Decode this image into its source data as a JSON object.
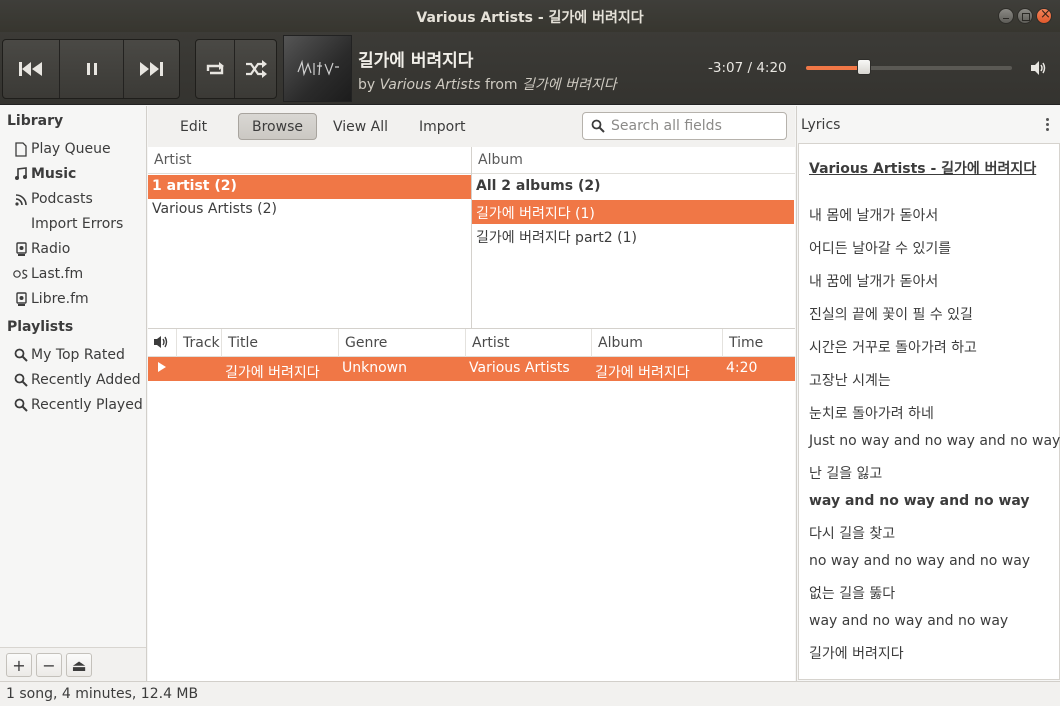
{
  "window": {
    "title": "Various Artists - 길가에 버려지다"
  },
  "now_playing": {
    "title": "길가에 버려지다",
    "by_prefix": "by",
    "artist": "Various Artists",
    "from_prefix": "from",
    "album": "길가에 버려지다",
    "time_display": "-3:07 / 4:20",
    "progress_fraction": 0.283
  },
  "sidebar": {
    "library_header": "Library",
    "library_items": [
      {
        "label": "Play Queue",
        "icon": "document-icon"
      },
      {
        "label": "Music",
        "icon": "music-note-icon",
        "bold": true
      },
      {
        "label": "Podcasts",
        "icon": "rss-feed-icon"
      },
      {
        "label": "Import Errors",
        "icon": ""
      },
      {
        "label": "Radio",
        "icon": "radio-icon"
      },
      {
        "label": "Last.fm",
        "icon": "lastfm-icon"
      },
      {
        "label": "Libre.fm",
        "icon": "librefm-icon"
      }
    ],
    "playlists_header": "Playlists",
    "playlist_items": [
      {
        "label": "My Top Rated",
        "icon": "search-icon"
      },
      {
        "label": "Recently Added",
        "icon": "search-icon"
      },
      {
        "label": "Recently Played",
        "icon": "search-icon"
      }
    ],
    "bottom_buttons": [
      "+",
      "−",
      "⏏"
    ]
  },
  "browser_toolbar": {
    "edit": "Edit",
    "browse": "Browse",
    "view_all": "View All",
    "import": "Import",
    "search_placeholder": "Search all fields"
  },
  "artist_pane": {
    "header": "Artist",
    "rows": [
      "1 artist (2)",
      "Various Artists (2)"
    ]
  },
  "album_pane": {
    "header": "Album",
    "rows": [
      "All 2 albums (2)",
      "길가에 버려지다 (1)",
      "길가에 버려지다 part2 (1)"
    ]
  },
  "tracklist": {
    "columns": [
      "Track",
      "Title",
      "Genre",
      "Artist",
      "Album",
      "Time"
    ],
    "rows": [
      {
        "track": "",
        "title": "길가에 버려지다",
        "genre": "Unknown",
        "artist": "Various Artists",
        "album": "길가에 버려지다",
        "time": "4:20"
      }
    ]
  },
  "lyrics": {
    "header": "Lyrics",
    "heading": "Various Artists - 길가에 버려지다",
    "lines": [
      "내 몸에 날개가 돋아서",
      "어디든 날아갈 수 있기를",
      "내 꿈에 날개가 돋아서",
      "진실의 끝에 꽃이 필 수 있길",
      "시간은 거꾸로 돌아가려 하고",
      "고장난 시계는",
      "눈치로 돌아가려 하네",
      "Just no way and no way and no way",
      "난 길을 잃고",
      "way and no way and no way",
      "다시 길을 찾고",
      "no way and no way and no way",
      "없는 길을 뚫다",
      "way and no way and no way",
      "길가에 버려지다"
    ]
  },
  "status_bar": {
    "text": "1 song, 4 minutes, 12.4 MB"
  },
  "colors": {
    "accent": "#f07746",
    "toolbar_bg": "#3c3b37"
  }
}
